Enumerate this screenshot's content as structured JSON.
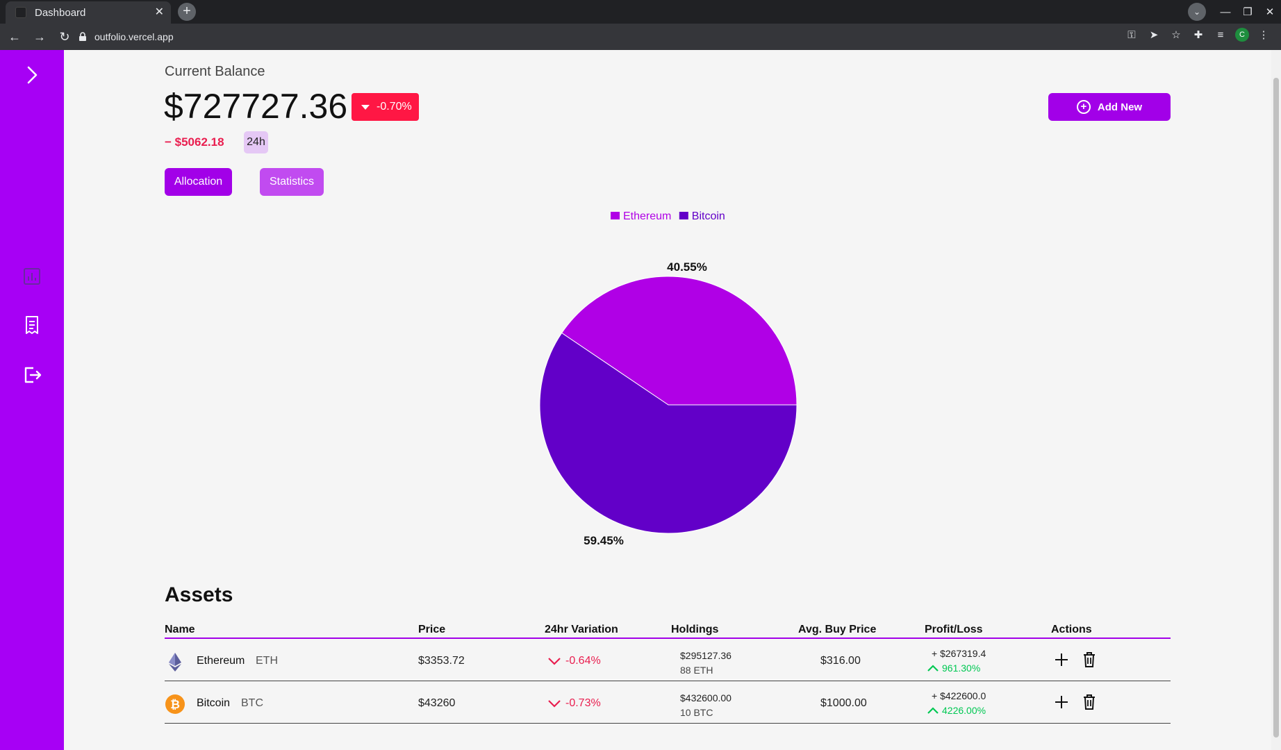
{
  "browser": {
    "tab_title": "Dashboard",
    "url": "outfolio.vercel.app",
    "profile_initial": "C"
  },
  "balance": {
    "label": "Current Balance",
    "value": "$727727.36",
    "change_pct": "-0.70%",
    "change_abs": "− $5062.18",
    "period": "24h"
  },
  "actions": {
    "allocation": "Allocation",
    "statistics": "Statistics",
    "add_new": "Add New"
  },
  "chart_data": {
    "type": "pie",
    "legend": [
      "Ethereum",
      "Bitcoin"
    ],
    "slices": [
      {
        "name": "Ethereum",
        "value": 40.55,
        "label": "40.55%",
        "color": "#b000e6"
      },
      {
        "name": "Bitcoin",
        "value": 59.45,
        "label": "59.45%",
        "color": "#6200c8"
      }
    ],
    "legend_placement": "top"
  },
  "assets": {
    "title": "Assets",
    "columns": [
      "Name",
      "Price",
      "24hr Variation",
      "Holdings",
      "Avg. Buy Price",
      "Profit/Loss",
      "Actions"
    ],
    "rows": [
      {
        "name": "Ethereum",
        "symbol": "ETH",
        "icon": "ethereum-icon",
        "price": "$3353.72",
        "variation": "-0.64%",
        "holdings_usd": "$295127.36",
        "holdings_amt": "88 ETH",
        "avg_buy": "$316.00",
        "pl_value": "+ $267319.4",
        "pl_pct": "961.30%"
      },
      {
        "name": "Bitcoin",
        "symbol": "BTC",
        "icon": "bitcoin-icon",
        "price": "$43260",
        "variation": "-0.73%",
        "holdings_usd": "$432600.00",
        "holdings_amt": "10 BTC",
        "avg_buy": "$1000.00",
        "pl_value": "+ $422600.0",
        "pl_pct": "4226.00%"
      }
    ]
  },
  "colors": {
    "accent": "#a700f5",
    "negative": "#ff1744",
    "positive": "#00c853"
  }
}
